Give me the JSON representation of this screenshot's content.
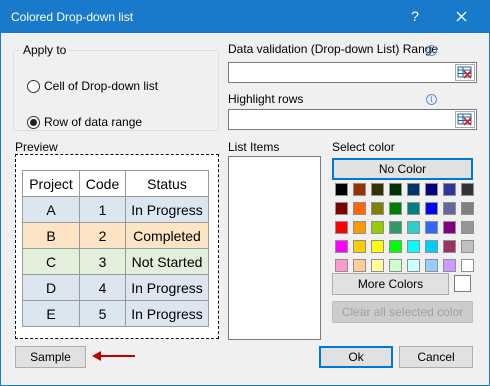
{
  "window": {
    "title": "Colored Drop-down list",
    "help_glyph": "?"
  },
  "apply_to": {
    "legend": "Apply to",
    "options": [
      {
        "label": "Cell of Drop-down list",
        "selected": false
      },
      {
        "label": "Row of data range",
        "selected": true
      }
    ]
  },
  "validation": {
    "label": "Data validation (Drop-down List) Range",
    "value": ""
  },
  "highlight": {
    "label": "Highlight rows",
    "value": ""
  },
  "info_glyph": "i",
  "preview": {
    "label": "Preview",
    "columns": [
      "Project",
      "Code",
      "Status"
    ],
    "rows": [
      [
        "A",
        "1",
        "In Progress"
      ],
      [
        "B",
        "2",
        "Completed"
      ],
      [
        "C",
        "3",
        "Not Started"
      ],
      [
        "D",
        "4",
        "In Progress"
      ],
      [
        "E",
        "5",
        "In Progress"
      ]
    ]
  },
  "list_items": {
    "label": "List Items"
  },
  "select_color": {
    "label": "Select color",
    "no_color": "No Color",
    "more_colors": "More Colors",
    "clear_all": "Clear all selected color",
    "palette": [
      [
        "#000000",
        "#993300",
        "#333300",
        "#003300",
        "#003366",
        "#000080",
        "#333399",
        "#333333"
      ],
      [
        "#800000",
        "#ff6600",
        "#808000",
        "#008000",
        "#008080",
        "#0000ff",
        "#666699",
        "#808080"
      ],
      [
        "#ff0000",
        "#ff9900",
        "#99cc00",
        "#339966",
        "#33cccc",
        "#3366ff",
        "#800080",
        "#969696"
      ],
      [
        "#ff00ff",
        "#ffcc00",
        "#ffff00",
        "#00ff00",
        "#00ffff",
        "#00ccff",
        "#993366",
        "#c0c0c0"
      ],
      [
        "#ff99cc",
        "#ffcc99",
        "#ffff99",
        "#ccffcc",
        "#ccffff",
        "#99ccff",
        "#cc99ff",
        "#ffffff"
      ]
    ]
  },
  "buttons": {
    "sample": "Sample",
    "ok": "Ok",
    "cancel": "Cancel"
  },
  "colors": {
    "titlebar": "#1979ca",
    "arrow": "#c00000",
    "accent_border": "#0078d7"
  }
}
